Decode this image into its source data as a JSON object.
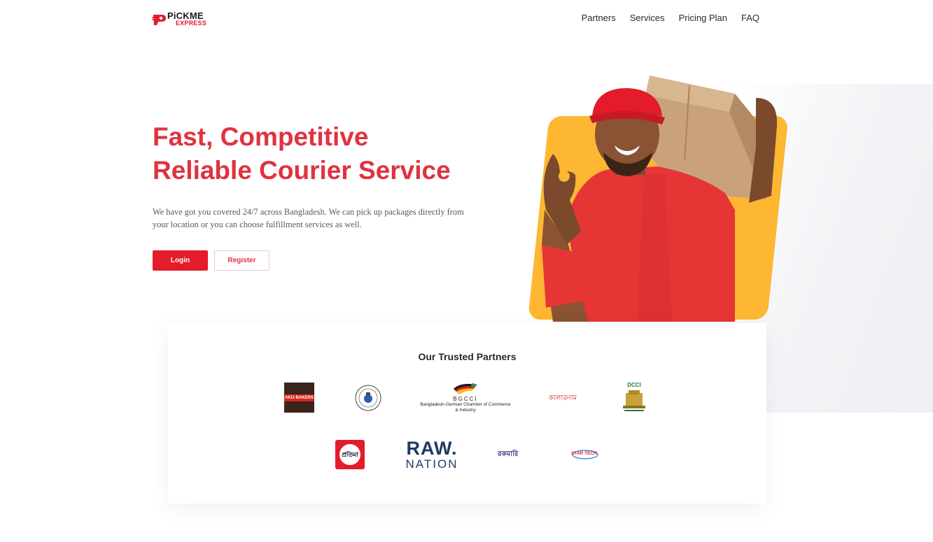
{
  "brand": {
    "logo_top": "PiCKME",
    "logo_bottom": "EXPRESS",
    "primary_color": "#e31b2b",
    "accent_color": "#fdb733"
  },
  "nav": {
    "items": [
      "Partners",
      "Services",
      "Pricing Plan",
      "FAQ"
    ]
  },
  "hero": {
    "title_line1": "Fast, Competitive",
    "title_line2": "Reliable Courier Service",
    "description": "We have got you covered 24/7 across Bangladesh. We can pick up packages directly from your location or you can choose fulfillment services as well.",
    "login_label": "Login",
    "register_label": "Register",
    "image_icon": "delivery-man-with-box-image"
  },
  "partners": {
    "title": "Our Trusted Partners",
    "logos": [
      {
        "name": "akij-bakers-logo",
        "text": "AKIJ BAKERS"
      },
      {
        "name": "university-seal-logo",
        "text": ""
      },
      {
        "name": "bgcci-logo",
        "text": "BGCCI",
        "subtext": "Bangladesh-German Chamber of Commerce & Industry"
      },
      {
        "name": "kalarnam-logo",
        "text": "কালারনাম"
      },
      {
        "name": "dcci-logo",
        "text": "DCCI"
      },
      {
        "name": "protisruti-logo",
        "text": "প্রতিমা"
      },
      {
        "name": "raw-nation-logo",
        "text": "RAW.",
        "subtext": "NATION"
      },
      {
        "name": "bokomari-logo",
        "text": "রকমারি"
      },
      {
        "name": "startech-logo",
        "text": "STAR TECH"
      }
    ]
  }
}
